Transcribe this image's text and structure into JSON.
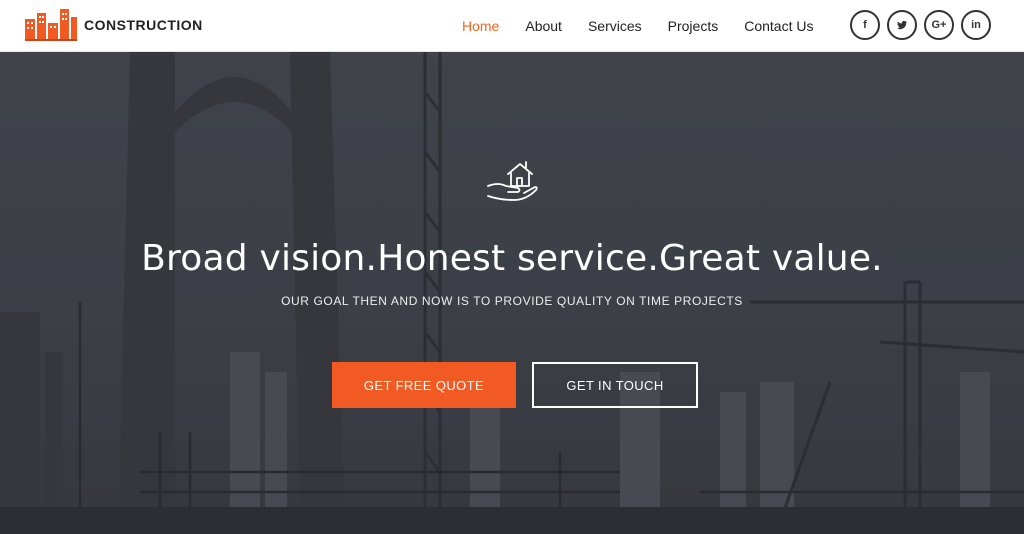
{
  "header": {
    "logo_text": "CONSTRUCTION",
    "nav": [
      {
        "label": "Home",
        "active": true
      },
      {
        "label": "About",
        "active": false
      },
      {
        "label": "Services",
        "active": false
      },
      {
        "label": "Projects",
        "active": false
      },
      {
        "label": "Contact Us",
        "active": false
      }
    ],
    "social": [
      {
        "icon": "facebook-icon",
        "glyph": "f"
      },
      {
        "icon": "twitter-icon",
        "glyph": ""
      },
      {
        "icon": "google-plus-icon",
        "glyph": "G+"
      },
      {
        "icon": "linkedin-icon",
        "glyph": "in"
      }
    ]
  },
  "hero": {
    "icon": "hand-house-icon",
    "headline": "Broad vision.Honest service.Great value.",
    "subline": "OUR GOAL THEN AND NOW IS TO PROVIDE QUALITY ON TIME PROJECTS",
    "primary_button": "GET FREE QUOTE",
    "secondary_button": "GET IN TOUCH"
  },
  "colors": {
    "accent": "#f15a22",
    "nav_active": "#f26522",
    "text_dark": "#222222"
  }
}
